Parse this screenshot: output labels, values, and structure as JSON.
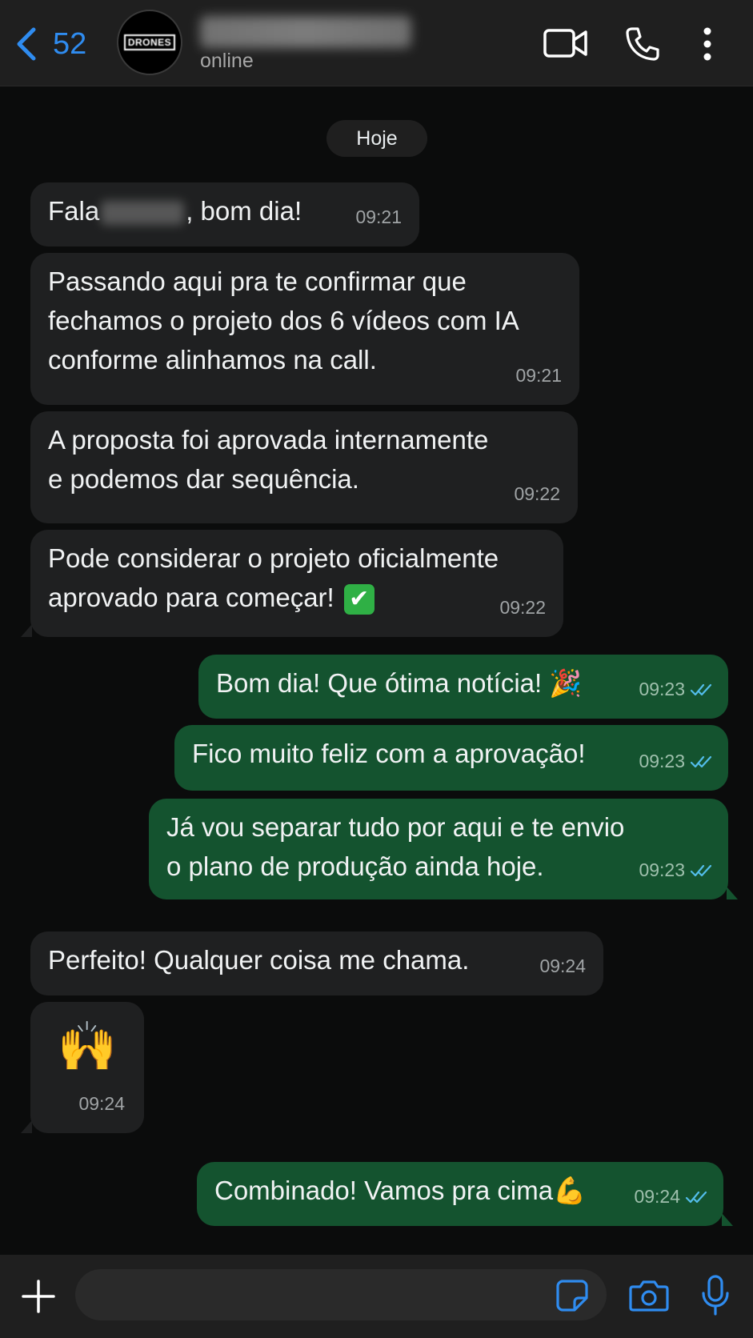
{
  "header": {
    "back_count": "52",
    "avatar_text_line1": "DRONES",
    "status": "online"
  },
  "chat": {
    "date_label": "Hoje",
    "messages": [
      {
        "dir": "in",
        "pre": "Fala",
        "post": ", bom dia!",
        "time": "09:21"
      },
      {
        "dir": "in",
        "text": "Passando aqui pra te confirmar que\nfechamos o projeto dos 6 vídeos com IA\nconforme alinhamos na call.",
        "time": "09:21"
      },
      {
        "dir": "in",
        "text": "A proposta foi aprovada internamente\ne podemos dar sequência.",
        "time": "09:22"
      },
      {
        "dir": "in",
        "text": "Pode considerar o projeto oficialmente\naprovado para começar!",
        "emoji": "✔",
        "time": "09:22"
      },
      {
        "dir": "out",
        "text": "Bom dia! Que ótima notícia!",
        "emoji": "🎉",
        "time": "09:23"
      },
      {
        "dir": "out",
        "text": "Fico muito feliz com a aprovação!",
        "time": "09:23"
      },
      {
        "dir": "out",
        "text": "Já vou separar tudo por aqui e te envio\no plano de produção ainda hoje.",
        "time": "09:23"
      },
      {
        "dir": "in",
        "text": "Perfeito! Qualquer coisa me chama.",
        "time": "09:24"
      },
      {
        "dir": "in",
        "emoji": "🙌",
        "time": "09:24"
      },
      {
        "dir": "out",
        "text": "Combinado! Vamos pra cima",
        "emoji": "💪",
        "time": "09:24"
      }
    ]
  },
  "footer": {
    "input_placeholder": ""
  },
  "colors": {
    "accent": "#2f8cf0",
    "incoming_bubble": "#1f2021",
    "outgoing_bubble": "#14532f",
    "read_ticks": "#53bdeb"
  },
  "icons": [
    "chevron-left-icon",
    "video-call-icon",
    "phone-icon",
    "more-vertical-icon",
    "plus-icon",
    "sticker-icon",
    "camera-icon",
    "microphone-icon",
    "double-check-icon"
  ]
}
